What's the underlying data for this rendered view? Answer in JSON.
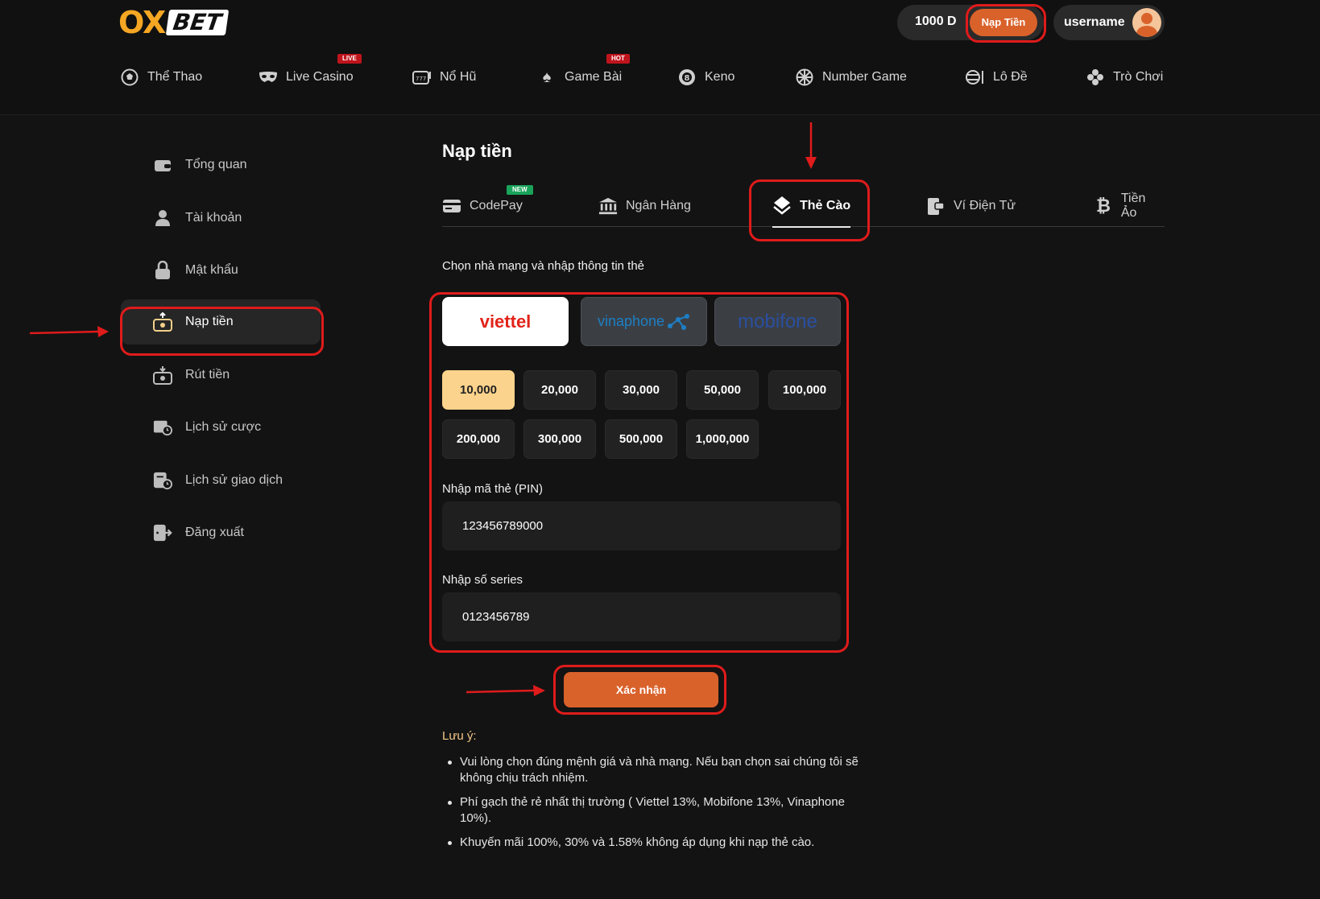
{
  "header": {
    "logo_ox": "OX",
    "logo_bet": "BET",
    "balance": "1000 D",
    "deposit_label": "Nạp Tiền",
    "username": "username"
  },
  "nav": [
    {
      "label": "Thể Thao",
      "icon": "soccer-ball-icon"
    },
    {
      "label": "Live Casino",
      "icon": "mask-icon",
      "badge": "LIVE"
    },
    {
      "label": "Nổ Hũ",
      "icon": "slot-machine-icon"
    },
    {
      "label": "Game Bài",
      "icon": "spade-icon",
      "badge": "HOT"
    },
    {
      "label": "Keno",
      "icon": "ball-8-icon"
    },
    {
      "label": "Number Game",
      "icon": "wheel-icon"
    },
    {
      "label": "Lô Đề",
      "icon": "lottery-icon"
    },
    {
      "label": "Trò Chơi",
      "icon": "gamepad-icon"
    }
  ],
  "sidebar": [
    {
      "label": "Tổng quan",
      "icon": "wallet-icon"
    },
    {
      "label": "Tài khoản",
      "icon": "user-icon"
    },
    {
      "label": "Mật khẩu",
      "icon": "lock-icon"
    },
    {
      "label": "Nạp tiền",
      "icon": "deposit-icon",
      "active": true
    },
    {
      "label": "Rút tiền",
      "icon": "withdraw-icon"
    },
    {
      "label": "Lịch sử cược",
      "icon": "bet-history-icon"
    },
    {
      "label": "Lịch sử giao dịch",
      "icon": "transaction-history-icon"
    },
    {
      "label": "Đăng xuất",
      "icon": "logout-icon"
    }
  ],
  "main": {
    "title": "Nạp tiền",
    "tabs": [
      {
        "label": "CodePay",
        "icon": "card-icon",
        "badge": "NEW"
      },
      {
        "label": "Ngân Hàng",
        "icon": "bank-icon"
      },
      {
        "label": "Thẻ Cào",
        "icon": "layers-icon",
        "active": true
      },
      {
        "label": "Ví Điện Tử",
        "icon": "e-wallet-icon"
      },
      {
        "label": "Tiền Ảo",
        "icon": "bitcoin-icon"
      }
    ],
    "instruction": "Chọn nhà mạng và nhập thông tin thẻ",
    "carriers": [
      {
        "name": "viettel",
        "selected": true
      },
      {
        "name": "vinaphone",
        "selected": false
      },
      {
        "name": "mobifone",
        "selected": false
      }
    ],
    "amounts": [
      "10,000",
      "20,000",
      "30,000",
      "50,000",
      "100,000",
      "200,000",
      "300,000",
      "500,000",
      "1,000,000"
    ],
    "selected_amount": "10,000",
    "pin_label": "Nhập mã thẻ (PIN)",
    "pin_value": "123456789000",
    "series_label": "Nhập số series",
    "series_value": "0123456789",
    "confirm_label": "Xác nhận",
    "note_title": "Lưu ý:",
    "notes": [
      "Vui lòng chọn đúng mệnh giá và nhà mạng. Nếu bạn chọn sai chúng tôi sẽ không chịu trách nhiệm.",
      "Phí gạch thẻ rẻ nhất thị trường ( Viettel 13%, Mobifone 13%, Vinaphone 10%).",
      "Khuyến mãi 100%, 30% và 1.58% không áp dụng khi nạp thẻ cào."
    ]
  },
  "colors": {
    "accent": "#d9622b",
    "logo": "#f5a623",
    "selected_amount": "#fcd38c",
    "annotation": "#e01b1b"
  }
}
